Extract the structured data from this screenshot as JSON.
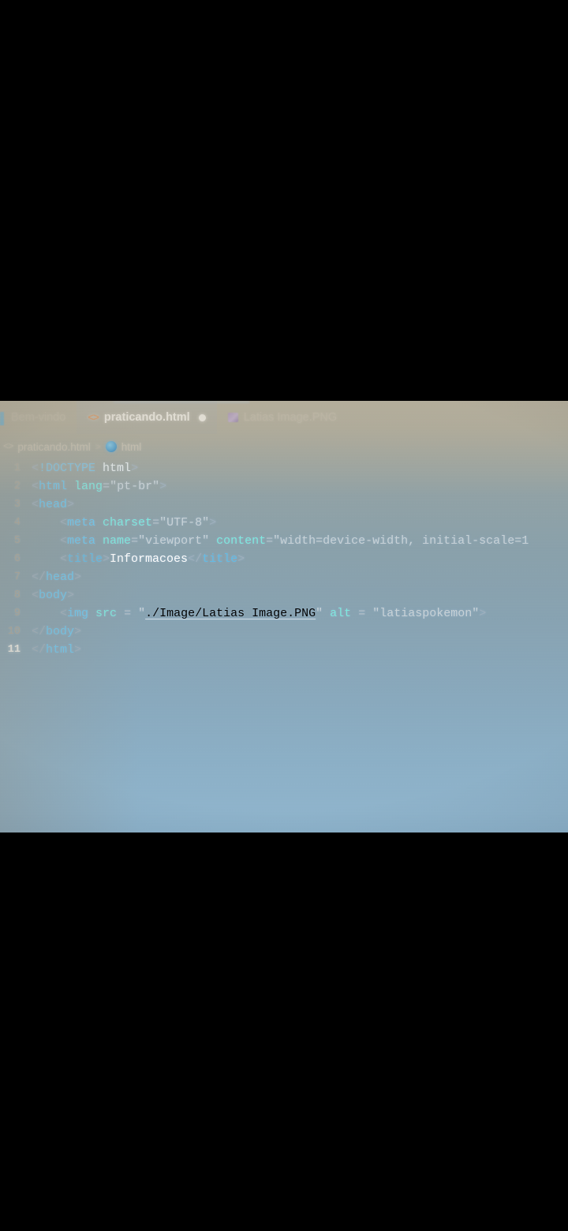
{
  "editor": {
    "tabs": [
      {
        "label": "Bem-vindo",
        "icon": "vscode-logo-icon",
        "active": false,
        "dirty": false
      },
      {
        "label": "praticando.html",
        "icon": "html-file-icon",
        "active": true,
        "dirty": true
      },
      {
        "label": "Latias Image.PNG",
        "icon": "image-file-icon",
        "active": false,
        "dirty": false
      }
    ],
    "breadcrumb": {
      "file_icon": "code-brackets-icon",
      "file": "praticando.html",
      "separator": ">",
      "symbol_icon": "html-element-icon",
      "symbol": "html"
    },
    "current_line": 11,
    "colors": {
      "tag": "#6ec8f0",
      "attribute": "#7fe9e0",
      "string": "#c9d3d8",
      "text": "#ffffff",
      "punctuation": "#9fb0bd",
      "dirty_dot": "#ffffff",
      "html_icon": "#e0864a",
      "active_accent": "#3fa9e8"
    },
    "lines": [
      {
        "number": "1",
        "indent": 1,
        "tokens": [
          {
            "text": "<",
            "type": "punct"
          },
          {
            "text": "!DOCTYPE",
            "type": "doctype"
          },
          {
            "text": " ",
            "type": "punct"
          },
          {
            "text": "html",
            "type": "dtname"
          },
          {
            "text": ">",
            "type": "punct"
          }
        ]
      },
      {
        "number": "2",
        "indent": 1,
        "tokens": [
          {
            "text": "<",
            "type": "punct"
          },
          {
            "text": "html",
            "type": "tag"
          },
          {
            "text": " ",
            "type": "punct"
          },
          {
            "text": "lang",
            "type": "attr"
          },
          {
            "text": "=",
            "type": "eq"
          },
          {
            "text": "\"pt-br\"",
            "type": "string"
          },
          {
            "text": ">",
            "type": "punct"
          }
        ]
      },
      {
        "number": "3",
        "indent": 1,
        "tokens": [
          {
            "text": "<",
            "type": "punct"
          },
          {
            "text": "head",
            "type": "tag"
          },
          {
            "text": ">",
            "type": "punct"
          }
        ]
      },
      {
        "number": "4",
        "indent": 2,
        "tokens": [
          {
            "text": "<",
            "type": "punct"
          },
          {
            "text": "meta",
            "type": "tag"
          },
          {
            "text": " ",
            "type": "punct"
          },
          {
            "text": "charset",
            "type": "attr"
          },
          {
            "text": "=",
            "type": "eq"
          },
          {
            "text": "\"UTF-8\"",
            "type": "string"
          },
          {
            "text": ">",
            "type": "punct"
          }
        ]
      },
      {
        "number": "5",
        "indent": 2,
        "tokens": [
          {
            "text": "<",
            "type": "punct"
          },
          {
            "text": "meta",
            "type": "tag"
          },
          {
            "text": " ",
            "type": "punct"
          },
          {
            "text": "name",
            "type": "attr"
          },
          {
            "text": "=",
            "type": "eq"
          },
          {
            "text": "\"viewport\"",
            "type": "string"
          },
          {
            "text": " ",
            "type": "punct"
          },
          {
            "text": "content",
            "type": "attr"
          },
          {
            "text": "=",
            "type": "eq"
          },
          {
            "text": "\"width=device-width, initial-scale=1",
            "type": "string"
          }
        ]
      },
      {
        "number": "6",
        "indent": 2,
        "tokens": [
          {
            "text": "<",
            "type": "punct"
          },
          {
            "text": "title",
            "type": "tagdim"
          },
          {
            "text": ">",
            "type": "punct"
          },
          {
            "text": "Informacoes",
            "type": "text"
          },
          {
            "text": "</",
            "type": "punct"
          },
          {
            "text": "title",
            "type": "tagdim"
          },
          {
            "text": ">",
            "type": "punct"
          }
        ]
      },
      {
        "number": "7",
        "indent": 1,
        "tokens": [
          {
            "text": "</",
            "type": "punct"
          },
          {
            "text": "head",
            "type": "tag"
          },
          {
            "text": ">",
            "type": "punct"
          }
        ]
      },
      {
        "number": "8",
        "indent": 1,
        "tokens": [
          {
            "text": "<",
            "type": "punct"
          },
          {
            "text": "body",
            "type": "tag"
          },
          {
            "text": ">",
            "type": "punct"
          }
        ]
      },
      {
        "number": "9",
        "indent": 2,
        "tokens": [
          {
            "text": "<",
            "type": "punct"
          },
          {
            "text": "img",
            "type": "tag"
          },
          {
            "text": " ",
            "type": "punct"
          },
          {
            "text": "src",
            "type": "attr"
          },
          {
            "text": " = ",
            "type": "eq"
          },
          {
            "text": "\"",
            "type": "string"
          },
          {
            "text": "./Image/Latias Image.PNG",
            "type": "link"
          },
          {
            "text": "\"",
            "type": "string"
          },
          {
            "text": " ",
            "type": "punct"
          },
          {
            "text": "alt",
            "type": "attr"
          },
          {
            "text": " = ",
            "type": "eq"
          },
          {
            "text": "\"latiaspokemon\"",
            "type": "string"
          },
          {
            "text": ">",
            "type": "punct"
          }
        ]
      },
      {
        "number": "10",
        "indent": 1,
        "tokens": [
          {
            "text": "</",
            "type": "punct"
          },
          {
            "text": "body",
            "type": "tag"
          },
          {
            "text": ">",
            "type": "punct"
          }
        ]
      },
      {
        "number": "11",
        "indent": 1,
        "current": true,
        "tokens": [
          {
            "text": "</",
            "type": "punct"
          },
          {
            "text": "html",
            "type": "tag"
          },
          {
            "text": ">",
            "type": "punct"
          }
        ]
      }
    ]
  }
}
